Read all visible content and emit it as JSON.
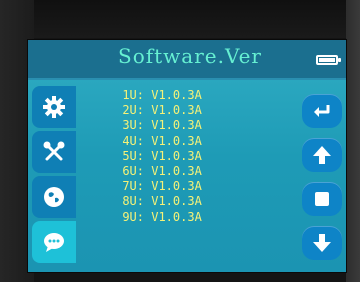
{
  "header": {
    "title": "Software.Ver",
    "battery_icon": "battery-full-icon"
  },
  "sidebar": {
    "items": [
      {
        "icon": "gear-icon",
        "selected": false
      },
      {
        "icon": "tools-icon",
        "selected": false
      },
      {
        "icon": "globe-icon",
        "selected": false
      },
      {
        "icon": "chat-icon",
        "selected": true
      }
    ]
  },
  "versions": [
    {
      "slot": "1U:",
      "version": "V1.0.3A"
    },
    {
      "slot": "2U:",
      "version": "V1.0.3A"
    },
    {
      "slot": "3U:",
      "version": "V1.0.3A"
    },
    {
      "slot": "4U:",
      "version": "V1.0.3A"
    },
    {
      "slot": "5U:",
      "version": "V1.0.3A"
    },
    {
      "slot": "6U:",
      "version": "V1.0.3A"
    },
    {
      "slot": "7U:",
      "version": "V1.0.3A"
    },
    {
      "slot": "8U:",
      "version": "V1.0.3A"
    },
    {
      "slot": "9U:",
      "version": "V1.0.3A"
    }
  ],
  "right_buttons": [
    {
      "icon": "return-icon"
    },
    {
      "icon": "arrow-up-icon"
    },
    {
      "icon": "stop-square-icon"
    },
    {
      "icon": "arrow-down-icon"
    }
  ],
  "colors": {
    "title": "#66f0d2",
    "version_text": "#f5f278",
    "button": "#0e84c7",
    "selected_tab": "#1ec1d8"
  }
}
